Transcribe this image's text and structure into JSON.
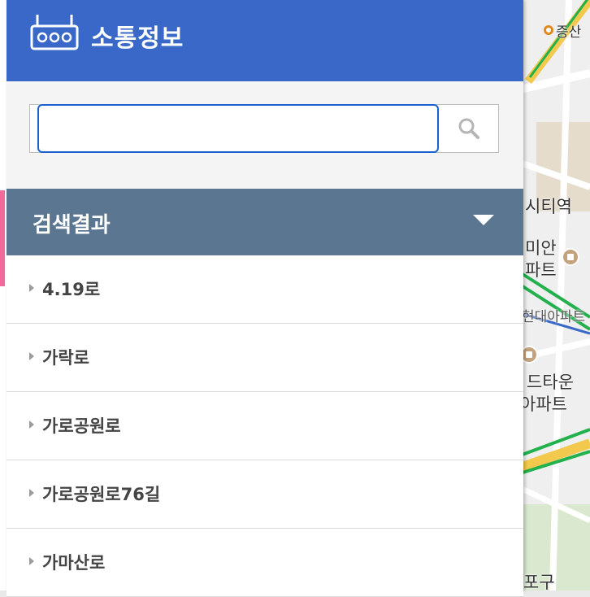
{
  "header": {
    "title": "소통정보",
    "icon": "traffic-camera-icon",
    "color": "#3a68c8"
  },
  "search": {
    "value": "",
    "placeholder": "",
    "button_icon": "search-icon"
  },
  "results": {
    "title": "검색결과",
    "toggle_icon": "caret-down-icon",
    "color": "#5b7691",
    "items": [
      {
        "label": "4.19로"
      },
      {
        "label": "가락로"
      },
      {
        "label": "가로공원로"
      },
      {
        "label": "가로공원로76길"
      },
      {
        "label": "가마산로"
      }
    ]
  },
  "map": {
    "labels": {
      "station": "증산",
      "l1": "시티역",
      "l2": "미안",
      "l3": "파트",
      "l4": "현대아파트",
      "l5": "드타운",
      "l6": "아파트",
      "l7": "포구"
    }
  }
}
